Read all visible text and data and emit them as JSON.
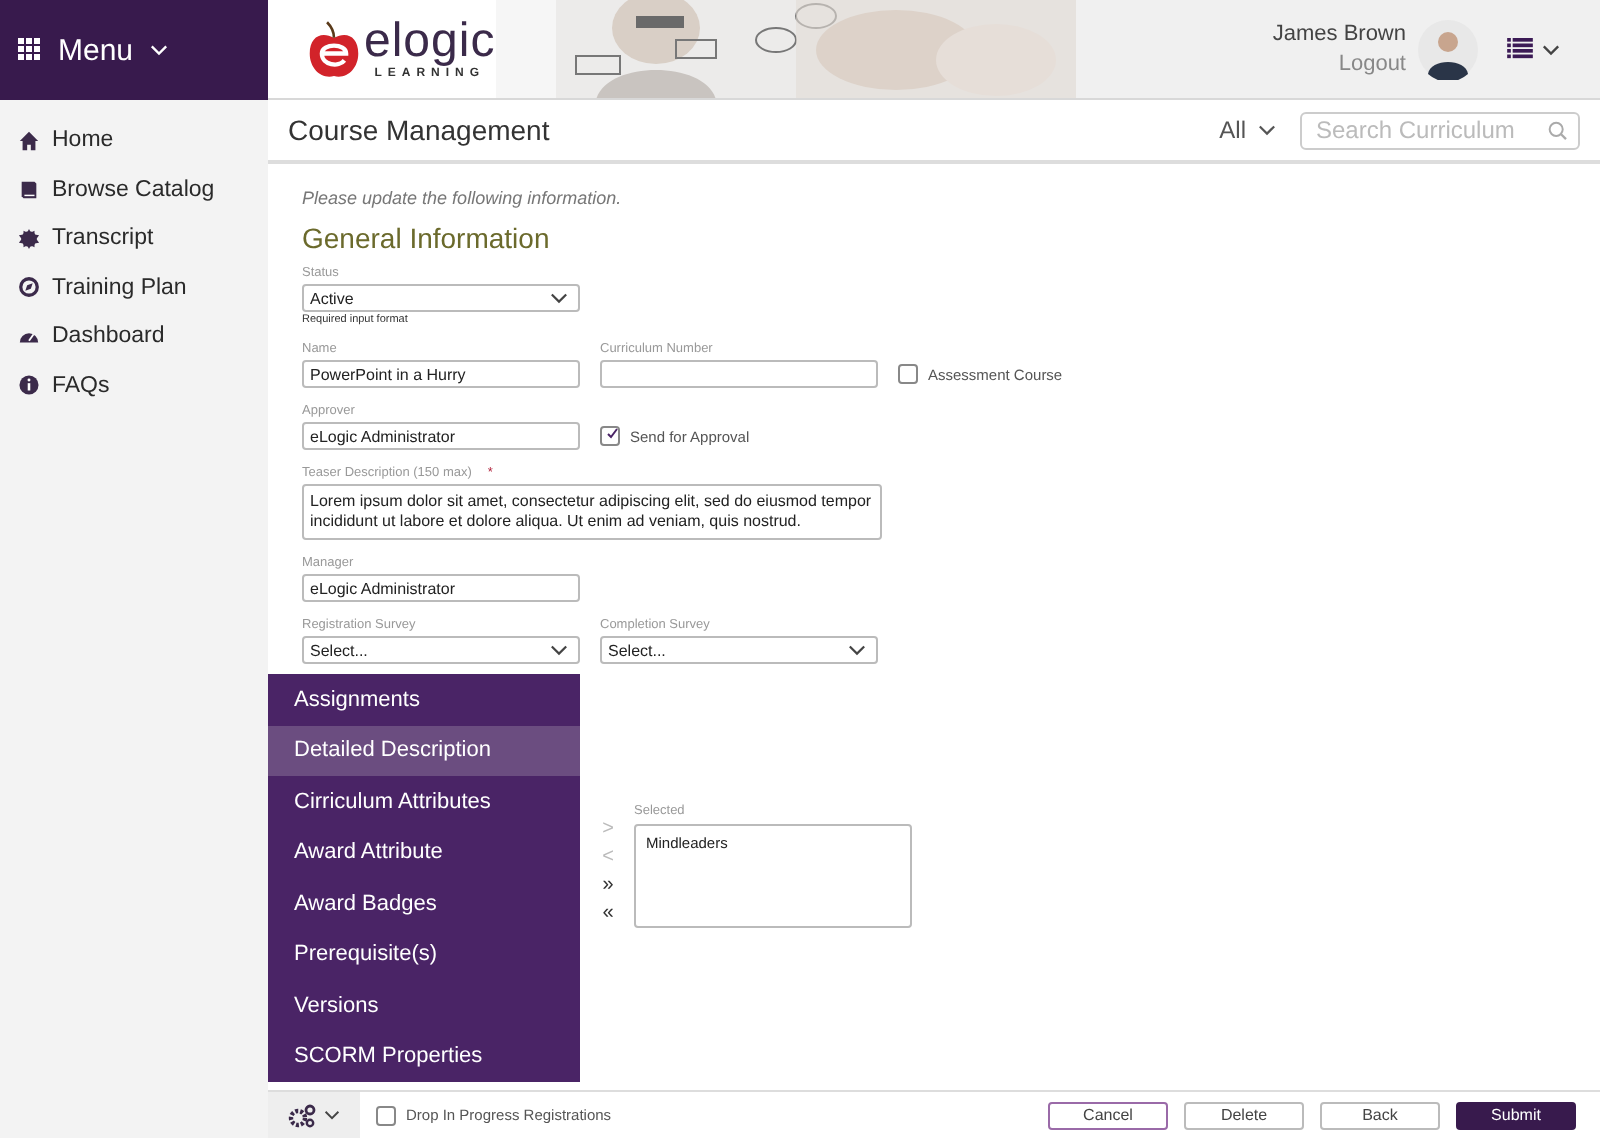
{
  "menu": {
    "label": "Menu"
  },
  "sidebar": {
    "items": [
      {
        "label": "Home",
        "kind": "home"
      },
      {
        "label": "Browse Catalog",
        "kind": "book"
      },
      {
        "label": "Transcript",
        "kind": "badge"
      },
      {
        "label": "Training Plan",
        "kind": "compass"
      },
      {
        "label": "Dashboard",
        "kind": "gauge"
      },
      {
        "label": "FAQs",
        "kind": "info"
      }
    ]
  },
  "logo": {
    "name": "elogic",
    "tagline": "LEARNING"
  },
  "user": {
    "name": "James Brown",
    "logout": "Logout"
  },
  "page": {
    "title": "Course Management",
    "filter": "All",
    "search_placeholder": "Search Curriculum"
  },
  "form": {
    "instruction": "Please update the following information.",
    "heading": "General Information",
    "rows": [
      [
        {
          "kind": "select",
          "label": "Status",
          "value": "Active",
          "hint": "Required input format"
        }
      ],
      [
        {
          "kind": "text",
          "label": "Name",
          "value": "PowerPoint in a Hurry"
        },
        {
          "kind": "text",
          "label": "Curriculum Number"
        },
        {
          "kind": "checkbox",
          "label": "Assessment Course",
          "checked": false
        }
      ],
      [
        {
          "kind": "text",
          "label": "Approver",
          "value": "eLogic Administrator"
        },
        {
          "kind": "checkbox",
          "label": "Send for Approval",
          "checked": true
        }
      ],
      [
        {
          "kind": "textarea",
          "label": "Teaser Description (150 max)",
          "required_mark": "*",
          "value": "Lorem ipsum dolor sit amet, consectetur adipiscing elit, sed do eiusmod tempor incididunt ut labore et dolore aliqua. Ut enim ad veniam, quis nostrud."
        }
      ],
      [
        {
          "kind": "text",
          "label": "Manager",
          "value": "eLogic Administrator"
        }
      ],
      [
        {
          "kind": "select",
          "label": "Registration Survey",
          "value": "Select..."
        },
        {
          "kind": "select",
          "label": "Completion Survey",
          "value": "Select..."
        }
      ]
    ],
    "transfer": {
      "buttons": [
        {
          "label": ">",
          "disabled": true
        },
        {
          "label": "<",
          "disabled": true
        },
        {
          "label": "»",
          "disabled": false
        },
        {
          "label": "«",
          "disabled": false
        }
      ],
      "selected_label": "Selected",
      "selected_items": [
        "Mindleaders"
      ]
    }
  },
  "section_menu": {
    "items": [
      {
        "label": "Assignments",
        "selected": false
      },
      {
        "label": "Detailed Description",
        "selected": true
      },
      {
        "label": "Cirriculum Attributes",
        "selected": false
      },
      {
        "label": "Award Attribute",
        "selected": false
      },
      {
        "label": "Award Badges",
        "selected": false
      },
      {
        "label": "Prerequisite(s)",
        "selected": false
      },
      {
        "label": "Versions",
        "selected": false
      },
      {
        "label": "SCORM Properties",
        "selected": false
      }
    ]
  },
  "footer": {
    "checkbox": {
      "label": "Drop In Progress Registrations",
      "checked": false
    },
    "buttons": [
      {
        "label": "Cancel",
        "kind": "outline"
      },
      {
        "label": "Delete",
        "kind": "plain"
      },
      {
        "label": "Back",
        "kind": "plain"
      },
      {
        "label": "Submit",
        "kind": "primary"
      }
    ]
  }
}
